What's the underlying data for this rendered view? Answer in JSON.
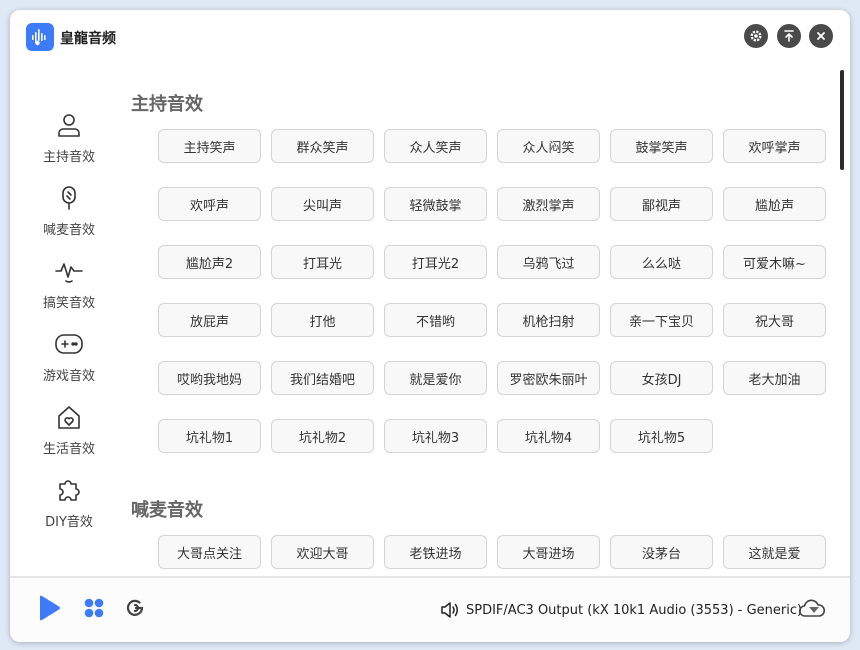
{
  "app": {
    "title": "皇龍音频"
  },
  "sidebar": {
    "items": [
      {
        "label": "主持音效"
      },
      {
        "label": "喊麦音效"
      },
      {
        "label": "搞笑音效"
      },
      {
        "label": "游戏音效"
      },
      {
        "label": "生活音效"
      },
      {
        "label": "DIY音效"
      }
    ]
  },
  "sections": [
    {
      "title": "主持音效",
      "buttons": [
        "主持笑声",
        "群众笑声",
        "众人笑声",
        "众人闷笑",
        "鼓掌笑声",
        "欢呼掌声",
        "欢呼声",
        "尖叫声",
        "轻微鼓掌",
        "激烈掌声",
        "鄙视声",
        "尴尬声",
        "尴尬声2",
        "打耳光",
        "打耳光2",
        "乌鸦飞过",
        "么么哒",
        "可爱木嘛~",
        "放屁声",
        "打他",
        "不错哟",
        "机枪扫射",
        "亲一下宝贝",
        "祝大哥",
        "哎哟我地妈",
        "我们结婚吧",
        "就是爱你",
        "罗密欧朱丽叶",
        "女孩DJ",
        "老大加油",
        "坑礼物1",
        "坑礼物2",
        "坑礼物3",
        "坑礼物4",
        "坑礼物5"
      ]
    },
    {
      "title": "喊麦音效",
      "buttons": [
        "大哥点关注",
        "欢迎大哥",
        "老铁进场",
        "大哥进场",
        "没茅台",
        "这就是爱"
      ]
    }
  ],
  "bottom": {
    "device": "SPDIF/AC3 Output (kX 10k1 Audio (3553) - Generic)"
  },
  "colors": {
    "accent": "#3d7bf7",
    "icon_dark": "#4a4a4a"
  }
}
